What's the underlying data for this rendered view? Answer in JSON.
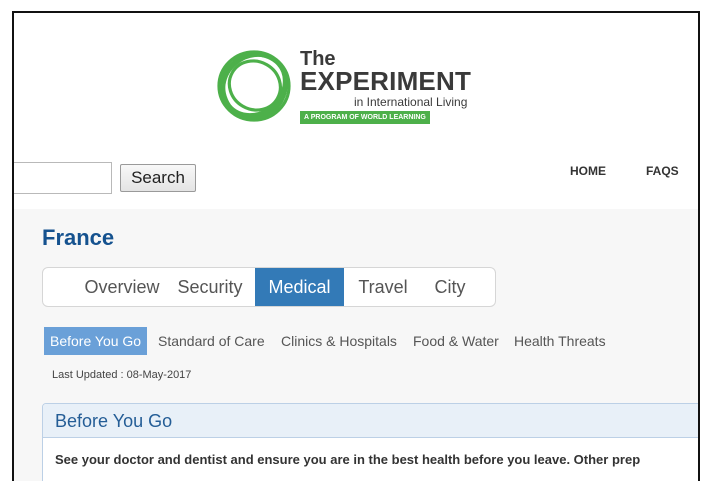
{
  "header": {
    "logo": {
      "the": "The",
      "experiment": "EXPERIMENT",
      "intl": "in International Living",
      "program": "A PROGRAM OF WORLD LEARNING",
      "ring_color": "#4db04a"
    },
    "search": {
      "input_value": "",
      "placeholder": "",
      "button_label": "Search"
    },
    "nav": [
      "HOME",
      "FAQS"
    ]
  },
  "main": {
    "country": "France",
    "tabs": [
      {
        "label": "Overview",
        "active": false
      },
      {
        "label": "Security",
        "active": false
      },
      {
        "label": "Medical",
        "active": true
      },
      {
        "label": "Travel",
        "active": false
      },
      {
        "label": "City",
        "active": false
      }
    ],
    "subtabs": [
      {
        "label": "Before You Go",
        "active": true
      },
      {
        "label": "Standard of Care",
        "active": false
      },
      {
        "label": "Clinics & Hospitals",
        "active": false
      },
      {
        "label": "Food & Water",
        "active": false
      },
      {
        "label": "Health Threats",
        "active": false
      }
    ],
    "last_updated": "Last Updated : 08-May-2017",
    "panel": {
      "title": "Before You Go",
      "body": "See your doctor and dentist and ensure you are in the best health before you leave. Other prep"
    }
  },
  "colors": {
    "accent": "#337ab7",
    "subtab_active": "#6aa0d8",
    "heading": "#15528f",
    "brand_green": "#4db04a"
  }
}
